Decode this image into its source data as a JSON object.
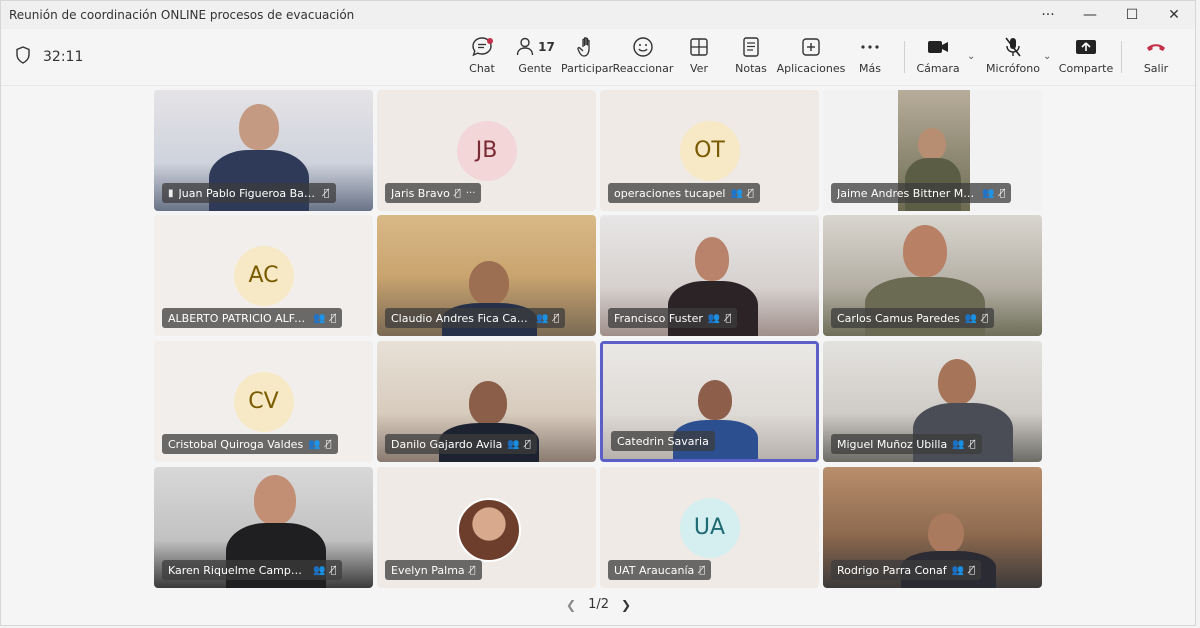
{
  "window": {
    "title": "Reunión de coordinación ONLINE procesos de evacuación",
    "controls": [
      "···",
      "—",
      "☐",
      "✕"
    ]
  },
  "status": {
    "timer": "32:11",
    "shield_icon": "shield-icon"
  },
  "toolbar": {
    "chat": "Chat",
    "people": "Gente",
    "people_count": "17",
    "raise_hand": "Participar",
    "react": "Reaccionar",
    "view": "Ver",
    "notes": "Notas",
    "apps": "Aplicaciones",
    "more": "Más",
    "camera": "Cámara",
    "mic": "Micrófono",
    "share": "Comparte",
    "leave": "Salir"
  },
  "participants": [
    {
      "name": "Juan Pablo Figueroa Barr...",
      "initials": "",
      "type": "video"
    },
    {
      "name": "Jaris Bravo",
      "initials": "JB",
      "type": "avatar",
      "avatar_bg": "#f3d6d8",
      "avatar_fg": "#7a2a34"
    },
    {
      "name": "operaciones tucapel",
      "initials": "OT",
      "type": "avatar",
      "avatar_bg": "#f7e9c6",
      "avatar_fg": "#7a5b00"
    },
    {
      "name": "Jaime Andres Bittner Marti...",
      "initials": "",
      "type": "video"
    },
    {
      "name": "ALBERTO PATRICIO ALFAR...",
      "initials": "AC",
      "type": "avatar",
      "avatar_bg": "#f7e9c6",
      "avatar_fg": "#7a5b00"
    },
    {
      "name": "Claudio Andres Fica Carrillo",
      "initials": "",
      "type": "video"
    },
    {
      "name": "Francisco Fuster",
      "initials": "",
      "type": "video"
    },
    {
      "name": "Carlos Camus Paredes",
      "initials": "",
      "type": "video"
    },
    {
      "name": "Cristobal Quiroga Valdes",
      "initials": "CV",
      "type": "avatar",
      "avatar_bg": "#f7e9c6",
      "avatar_fg": "#7a5b00"
    },
    {
      "name": "Danilo Gajardo Avila",
      "initials": "",
      "type": "video"
    },
    {
      "name": "Catedrin Savaria",
      "initials": "",
      "type": "video"
    },
    {
      "name": "Miguel Muñoz Ubilla",
      "initials": "",
      "type": "video"
    },
    {
      "name": "Karen Riquelme Campos (V...",
      "initials": "",
      "type": "video"
    },
    {
      "name": "Evelyn Palma",
      "initials": "",
      "type": "photo"
    },
    {
      "name": "UAT Araucanía",
      "initials": "UA",
      "type": "avatar",
      "avatar_bg": "#d5eef0",
      "avatar_fg": "#1f6b73"
    },
    {
      "name": "Rodrigo Parra Conaf",
      "initials": "",
      "type": "video"
    }
  ],
  "pager": {
    "label": "1/2"
  }
}
